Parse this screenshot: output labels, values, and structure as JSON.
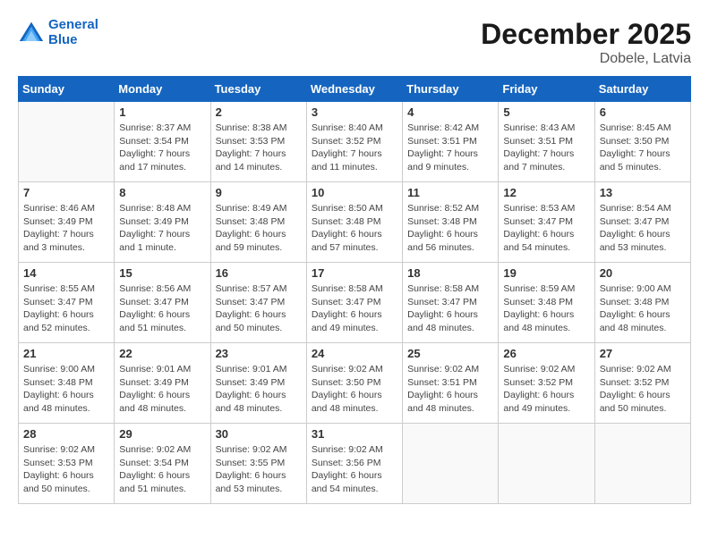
{
  "header": {
    "logo_line1": "General",
    "logo_line2": "Blue",
    "month_title": "December 2025",
    "location": "Dobele, Latvia"
  },
  "weekdays": [
    "Sunday",
    "Monday",
    "Tuesday",
    "Wednesday",
    "Thursday",
    "Friday",
    "Saturday"
  ],
  "weeks": [
    [
      {
        "day": "",
        "info": ""
      },
      {
        "day": "1",
        "info": "Sunrise: 8:37 AM\nSunset: 3:54 PM\nDaylight: 7 hours\nand 17 minutes."
      },
      {
        "day": "2",
        "info": "Sunrise: 8:38 AM\nSunset: 3:53 PM\nDaylight: 7 hours\nand 14 minutes."
      },
      {
        "day": "3",
        "info": "Sunrise: 8:40 AM\nSunset: 3:52 PM\nDaylight: 7 hours\nand 11 minutes."
      },
      {
        "day": "4",
        "info": "Sunrise: 8:42 AM\nSunset: 3:51 PM\nDaylight: 7 hours\nand 9 minutes."
      },
      {
        "day": "5",
        "info": "Sunrise: 8:43 AM\nSunset: 3:51 PM\nDaylight: 7 hours\nand 7 minutes."
      },
      {
        "day": "6",
        "info": "Sunrise: 8:45 AM\nSunset: 3:50 PM\nDaylight: 7 hours\nand 5 minutes."
      }
    ],
    [
      {
        "day": "7",
        "info": "Sunrise: 8:46 AM\nSunset: 3:49 PM\nDaylight: 7 hours\nand 3 minutes."
      },
      {
        "day": "8",
        "info": "Sunrise: 8:48 AM\nSunset: 3:49 PM\nDaylight: 7 hours\nand 1 minute."
      },
      {
        "day": "9",
        "info": "Sunrise: 8:49 AM\nSunset: 3:48 PM\nDaylight: 6 hours\nand 59 minutes."
      },
      {
        "day": "10",
        "info": "Sunrise: 8:50 AM\nSunset: 3:48 PM\nDaylight: 6 hours\nand 57 minutes."
      },
      {
        "day": "11",
        "info": "Sunrise: 8:52 AM\nSunset: 3:48 PM\nDaylight: 6 hours\nand 56 minutes."
      },
      {
        "day": "12",
        "info": "Sunrise: 8:53 AM\nSunset: 3:47 PM\nDaylight: 6 hours\nand 54 minutes."
      },
      {
        "day": "13",
        "info": "Sunrise: 8:54 AM\nSunset: 3:47 PM\nDaylight: 6 hours\nand 53 minutes."
      }
    ],
    [
      {
        "day": "14",
        "info": "Sunrise: 8:55 AM\nSunset: 3:47 PM\nDaylight: 6 hours\nand 52 minutes."
      },
      {
        "day": "15",
        "info": "Sunrise: 8:56 AM\nSunset: 3:47 PM\nDaylight: 6 hours\nand 51 minutes."
      },
      {
        "day": "16",
        "info": "Sunrise: 8:57 AM\nSunset: 3:47 PM\nDaylight: 6 hours\nand 50 minutes."
      },
      {
        "day": "17",
        "info": "Sunrise: 8:58 AM\nSunset: 3:47 PM\nDaylight: 6 hours\nand 49 minutes."
      },
      {
        "day": "18",
        "info": "Sunrise: 8:58 AM\nSunset: 3:47 PM\nDaylight: 6 hours\nand 48 minutes."
      },
      {
        "day": "19",
        "info": "Sunrise: 8:59 AM\nSunset: 3:48 PM\nDaylight: 6 hours\nand 48 minutes."
      },
      {
        "day": "20",
        "info": "Sunrise: 9:00 AM\nSunset: 3:48 PM\nDaylight: 6 hours\nand 48 minutes."
      }
    ],
    [
      {
        "day": "21",
        "info": "Sunrise: 9:00 AM\nSunset: 3:48 PM\nDaylight: 6 hours\nand 48 minutes."
      },
      {
        "day": "22",
        "info": "Sunrise: 9:01 AM\nSunset: 3:49 PM\nDaylight: 6 hours\nand 48 minutes."
      },
      {
        "day": "23",
        "info": "Sunrise: 9:01 AM\nSunset: 3:49 PM\nDaylight: 6 hours\nand 48 minutes."
      },
      {
        "day": "24",
        "info": "Sunrise: 9:02 AM\nSunset: 3:50 PM\nDaylight: 6 hours\nand 48 minutes."
      },
      {
        "day": "25",
        "info": "Sunrise: 9:02 AM\nSunset: 3:51 PM\nDaylight: 6 hours\nand 48 minutes."
      },
      {
        "day": "26",
        "info": "Sunrise: 9:02 AM\nSunset: 3:52 PM\nDaylight: 6 hours\nand 49 minutes."
      },
      {
        "day": "27",
        "info": "Sunrise: 9:02 AM\nSunset: 3:52 PM\nDaylight: 6 hours\nand 50 minutes."
      }
    ],
    [
      {
        "day": "28",
        "info": "Sunrise: 9:02 AM\nSunset: 3:53 PM\nDaylight: 6 hours\nand 50 minutes."
      },
      {
        "day": "29",
        "info": "Sunrise: 9:02 AM\nSunset: 3:54 PM\nDaylight: 6 hours\nand 51 minutes."
      },
      {
        "day": "30",
        "info": "Sunrise: 9:02 AM\nSunset: 3:55 PM\nDaylight: 6 hours\nand 53 minutes."
      },
      {
        "day": "31",
        "info": "Sunrise: 9:02 AM\nSunset: 3:56 PM\nDaylight: 6 hours\nand 54 minutes."
      },
      {
        "day": "",
        "info": ""
      },
      {
        "day": "",
        "info": ""
      },
      {
        "day": "",
        "info": ""
      }
    ]
  ]
}
